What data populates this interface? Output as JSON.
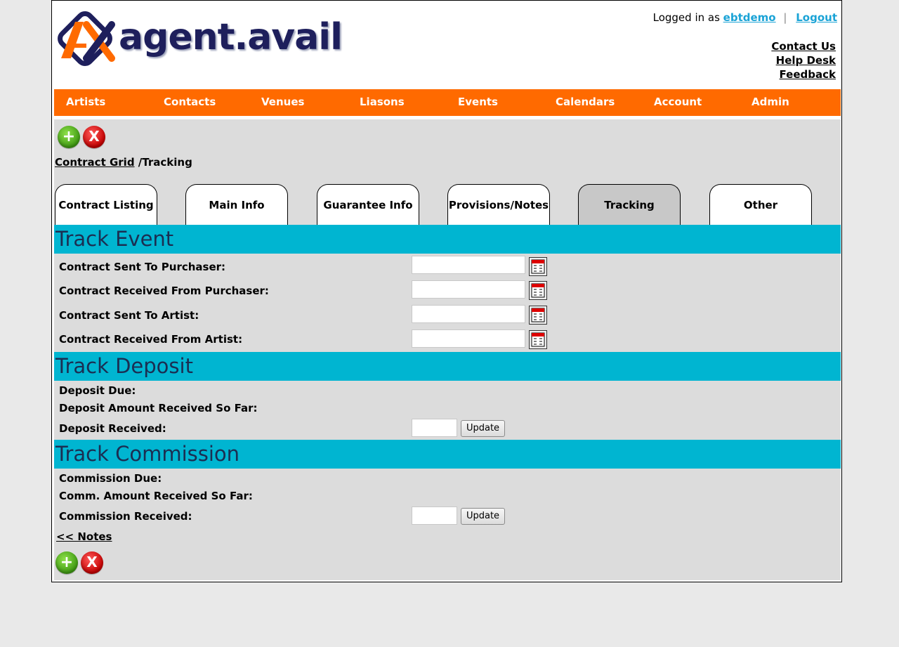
{
  "header": {
    "brand": "agent.avail",
    "logged_in_prefix": "Logged in as",
    "username": "ebtdemo",
    "separator": "|",
    "logout": "Logout",
    "links": [
      "Contact Us",
      "Help Desk",
      "Feedback"
    ]
  },
  "nav": {
    "items": [
      "Artists",
      "Contacts",
      "Venues",
      "Liasons",
      "Events",
      "Calendars",
      "Account",
      "Admin"
    ]
  },
  "toolbar": {
    "add_icon": "+",
    "delete_icon": "X"
  },
  "breadcrumb": {
    "link": "Contract Grid",
    "current": "/Tracking"
  },
  "tabs": {
    "items": [
      "Contract Listing",
      "Main Info",
      "Guarantee Info",
      "Provisions/Notes",
      "Tracking",
      "Other"
    ],
    "active": "Tracking"
  },
  "track_event": {
    "title": "Track Event",
    "fields": [
      {
        "label": "Contract Sent To Purchaser:",
        "value": ""
      },
      {
        "label": "Contract Received From Purchaser:",
        "value": ""
      },
      {
        "label": "Contract Sent To Artist:",
        "value": ""
      },
      {
        "label": "Contract Received From Artist:",
        "value": ""
      }
    ]
  },
  "track_deposit": {
    "title": "Track Deposit",
    "due_label": "Deposit Due:",
    "received_so_far_label": "Deposit Amount Received So Far:",
    "received_label": "Deposit Received:",
    "received_value": "",
    "update_label": "Update"
  },
  "track_commission": {
    "title": "Track Commission",
    "due_label": "Commission Due:",
    "received_so_far_label": "Comm. Amount Received So Far:",
    "received_label": "Commission Received:",
    "received_value": "",
    "update_label": "Update"
  },
  "notes_link": "<< Notes",
  "colors": {
    "nav_bg": "#ff6a00",
    "section_bg": "#00b5d1",
    "add_button": "#3f9a12",
    "delete_button": "#c40000",
    "username_link": "#1aa3d6"
  },
  "icons": {
    "logo": "ax-logo-icon",
    "calendar": "calendar-icon",
    "add": "add-icon",
    "delete": "delete-icon"
  }
}
